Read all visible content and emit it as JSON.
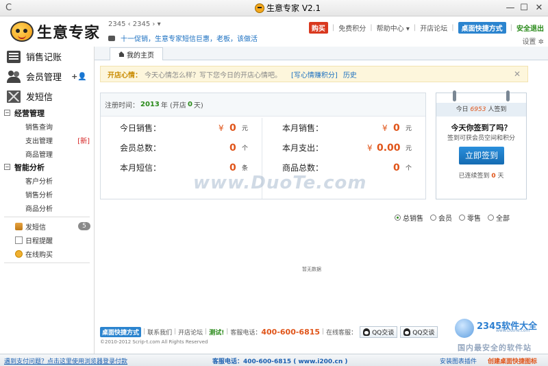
{
  "window": {
    "title": "生意专家 V2.1",
    "refresh_glyph": "C",
    "minimize_glyph": "—",
    "maximize_glyph": "☐",
    "close_glyph": "✕"
  },
  "header": {
    "logo_text": "生意专家",
    "account": "2345 ‹ 2345 › ▾",
    "promo": "十一促销，生意专家短信巨惠，老板，该做活",
    "buy_label": "购买",
    "points_label": "免费积分",
    "help_label": "帮助中心 ▾",
    "forum_label": "开店论坛",
    "desktop_label": "桌面快捷方式",
    "logout_label": "安全退出",
    "settings_label": "设置 ✲"
  },
  "sidebar": {
    "sales_label": "销售记账",
    "member_label": "会员管理",
    "add_member_glyph": "+👤",
    "sms_label": "发短信",
    "group_ops": "经营管理",
    "group_ops_glyph": "−",
    "ops_items": [
      "销售查询",
      "支出管理",
      "商品管理"
    ],
    "new_tag": "[新]",
    "group_analysis": "智能分析",
    "group_analysis_glyph": "−",
    "analysis_items": [
      "客户分析",
      "销售分析",
      "商品分析"
    ],
    "tools": [
      {
        "label": "发短信",
        "icon": "phone-icon"
      },
      {
        "label": "日程提醒",
        "icon": "calendar-icon"
      },
      {
        "label": "在线购买",
        "icon": "cart-icon"
      }
    ],
    "sms_badge": "5"
  },
  "tabs": {
    "home_label": "我的主页"
  },
  "notice": {
    "label": "开店心情：",
    "text": "今天心情怎么样？写下您今日的开店心情吧。",
    "link1": "[写心情赚积分]",
    "link2": "历史",
    "close_glyph": "✕"
  },
  "stats": {
    "reg_prefix": "注册时间：",
    "reg_year": "2013",
    "reg_year_suffix": "年 (开店",
    "reg_days": "0",
    "reg_days_suffix": "天)",
    "currency": "¥",
    "today_sales_label": "今日销售：",
    "today_sales_value": "0",
    "yuan": "元",
    "members_label": "会员总数：",
    "members_value": "0",
    "ge": "个",
    "month_sms_label": "本月短信：",
    "month_sms_value": "0",
    "tiao": "条",
    "month_sales_label": "本月销售：",
    "month_sales_value": "0",
    "month_expense_label": "本月支出：",
    "month_expense_value": "0.00",
    "products_label": "商品总数：",
    "products_value": "0"
  },
  "signin": {
    "count_prefix": "今日",
    "count": "6953",
    "count_suffix": "人签到",
    "question": "今天你签到了吗？",
    "subtitle": "签到可获会员空间和积分",
    "button": "立即签到",
    "consecutive_prefix": "已连续签到",
    "consecutive_days": "0",
    "consecutive_suffix": "天"
  },
  "chart_filter": {
    "options": [
      "总销售",
      "会员",
      "零售",
      "全部"
    ],
    "selected": "总销售"
  },
  "nodata": "暂无数据",
  "footer": {
    "desktop_btn": "桌面快捷方式",
    "contact": "联系我们",
    "forum": "开店论坛",
    "test": "测试!",
    "hotline_label": "客服电话：",
    "hotline": "400-600-6815",
    "online_label": "在线客服：",
    "qq1": "QQ交谈",
    "qq2": "QQ交谈",
    "copyright": "©2010-2012 Scrip-t.com All Rights Reserved"
  },
  "watermarks": {
    "duote": "www.DuoTe.com",
    "brand": "2345软件大全",
    "site": "www.DuoTe.com",
    "tagline": "国内最安全的软件站"
  },
  "statusbar": {
    "help_link": "遇到支付问题？点击这里使用浏览器登录付款",
    "hotline": "客服电话：400-600-6815 ( www.i200.cn )",
    "install_plugin": "安装图表插件",
    "create_shortcut": "创建桌面快捷图标"
  }
}
